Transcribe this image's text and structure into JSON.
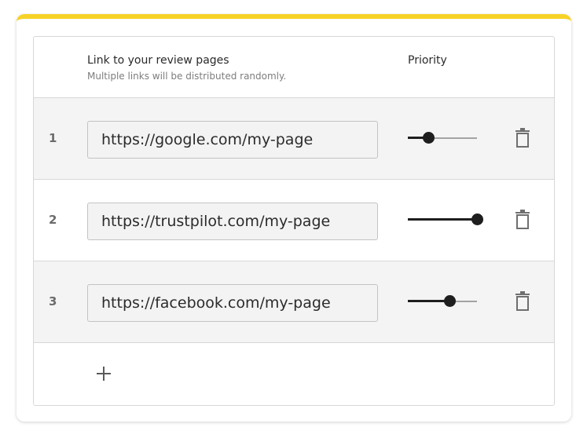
{
  "header": {
    "title": "Link to your review pages",
    "subtitle": "Multiple links will be distributed randomly.",
    "priority_label": "Priority"
  },
  "rows": [
    {
      "number": "1",
      "url": "https://google.com/my-page",
      "priority": 0.3,
      "delete_icon": "trash-icon"
    },
    {
      "number": "2",
      "url": "https://trustpilot.com/my-page",
      "priority": 1.0,
      "delete_icon": "trash-icon"
    },
    {
      "number": "3",
      "url": "https://facebook.com/my-page",
      "priority": 0.6,
      "delete_icon": "trash-icon"
    }
  ],
  "add_icon": "plus-icon",
  "colors": {
    "accent": "#f7d226",
    "slider_active": "#1e1e1e",
    "slider_inactive": "#a3a3a3",
    "row_shaded": "#f4f4f4"
  }
}
